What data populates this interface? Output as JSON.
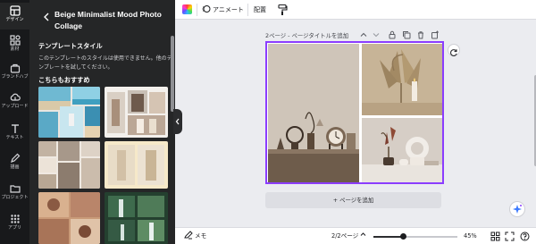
{
  "rail": [
    {
      "id": "design",
      "label": "デザイン",
      "active": true
    },
    {
      "id": "elements",
      "label": "素材"
    },
    {
      "id": "brand",
      "label": "ブランドハブ"
    },
    {
      "id": "uploads",
      "label": "アップロード"
    },
    {
      "id": "text",
      "label": "テキスト"
    },
    {
      "id": "draw",
      "label": "描画"
    },
    {
      "id": "projects",
      "label": "プロジェクト"
    },
    {
      "id": "apps",
      "label": "アプリ"
    }
  ],
  "panel": {
    "title": "Beige Minimalist Mood Photo Collage",
    "style_heading": "テンプレートスタイル",
    "style_desc": "このテンプレートのスタイルは使用できません。他のテンプレートを試してください。",
    "rec_heading": "こちらもおすすめ"
  },
  "toolbar": {
    "animate": "アニメート",
    "position": "配置"
  },
  "canvas": {
    "page_label": "2ページ - ページタイトルを追加",
    "add_page": "+ ページを追加"
  },
  "bottombar": {
    "notes": "メモ",
    "pages": "2/2ページ",
    "zoom_text": "45%",
    "zoom_fraction": 0.36
  },
  "colors": {
    "accent": "#8b3dff",
    "rail_bg": "#18191b",
    "panel_bg": "#252627",
    "canvas_bg": "#ebecf0"
  }
}
